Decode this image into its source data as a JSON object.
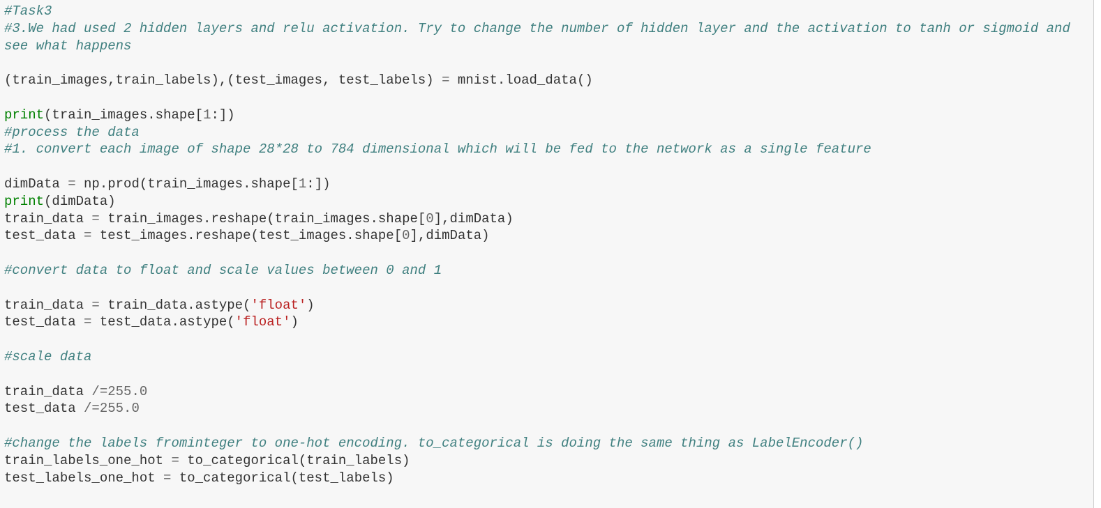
{
  "colors": {
    "background": "#f7f7f7",
    "comment": "#408080",
    "keyword": "#008000",
    "string": "#ba2121",
    "number": "#666666",
    "text": "#333333"
  },
  "code_lines": [
    [
      [
        "c",
        "#Task3"
      ]
    ],
    [
      [
        "c",
        "#3.We had used 2 hidden layers and relu activation. Try to change the number of hidden layer and the activation to tanh or sigmoid and"
      ]
    ],
    [
      [
        "c",
        "see what happens"
      ]
    ],
    [],
    [
      [
        "t",
        "(train_images,train_labels),(test_images, test_labels) "
      ],
      [
        "o",
        "="
      ],
      [
        "t",
        " mnist.load_data()"
      ]
    ],
    [],
    [
      [
        "k",
        "print"
      ],
      [
        "t",
        "(train_images.shape["
      ],
      [
        "n",
        "1"
      ],
      [
        "t",
        ":])"
      ]
    ],
    [
      [
        "c",
        "#process the data"
      ]
    ],
    [
      [
        "c",
        "#1. convert each image of shape 28*28 to 784 dimensional which will be fed to the network as a single feature"
      ]
    ],
    [],
    [
      [
        "t",
        "dimData "
      ],
      [
        "o",
        "="
      ],
      [
        "t",
        " np.prod(train_images.shape["
      ],
      [
        "n",
        "1"
      ],
      [
        "t",
        ":])"
      ]
    ],
    [
      [
        "k",
        "print"
      ],
      [
        "t",
        "(dimData)"
      ]
    ],
    [
      [
        "t",
        "train_data "
      ],
      [
        "o",
        "="
      ],
      [
        "t",
        " train_images.reshape(train_images.shape["
      ],
      [
        "n",
        "0"
      ],
      [
        "t",
        "],dimData)"
      ]
    ],
    [
      [
        "t",
        "test_data "
      ],
      [
        "o",
        "="
      ],
      [
        "t",
        " test_images.reshape(test_images.shape["
      ],
      [
        "n",
        "0"
      ],
      [
        "t",
        "],dimData)"
      ]
    ],
    [],
    [
      [
        "c",
        "#convert data to float and scale values between 0 and 1"
      ]
    ],
    [],
    [
      [
        "t",
        "train_data "
      ],
      [
        "o",
        "="
      ],
      [
        "t",
        " train_data.astype("
      ],
      [
        "s",
        "'float'"
      ],
      [
        "t",
        ")"
      ]
    ],
    [
      [
        "t",
        "test_data "
      ],
      [
        "o",
        "="
      ],
      [
        "t",
        " test_data.astype("
      ],
      [
        "s",
        "'float'"
      ],
      [
        "t",
        ")"
      ]
    ],
    [],
    [
      [
        "c",
        "#scale data"
      ]
    ],
    [],
    [
      [
        "t",
        "train_data "
      ],
      [
        "o",
        "/="
      ],
      [
        "n",
        "255.0"
      ]
    ],
    [
      [
        "t",
        "test_data "
      ],
      [
        "o",
        "/="
      ],
      [
        "n",
        "255.0"
      ]
    ],
    [],
    [
      [
        "c",
        "#change the labels frominteger to one-hot encoding. to_categorical is doing the same thing as LabelEncoder()"
      ]
    ],
    [
      [
        "t",
        "train_labels_one_hot "
      ],
      [
        "o",
        "="
      ],
      [
        "t",
        " to_categorical(train_labels)"
      ]
    ],
    [
      [
        "t",
        "test_labels_one_hot "
      ],
      [
        "o",
        "="
      ],
      [
        "t",
        " to_categorical(test_labels)"
      ]
    ]
  ]
}
